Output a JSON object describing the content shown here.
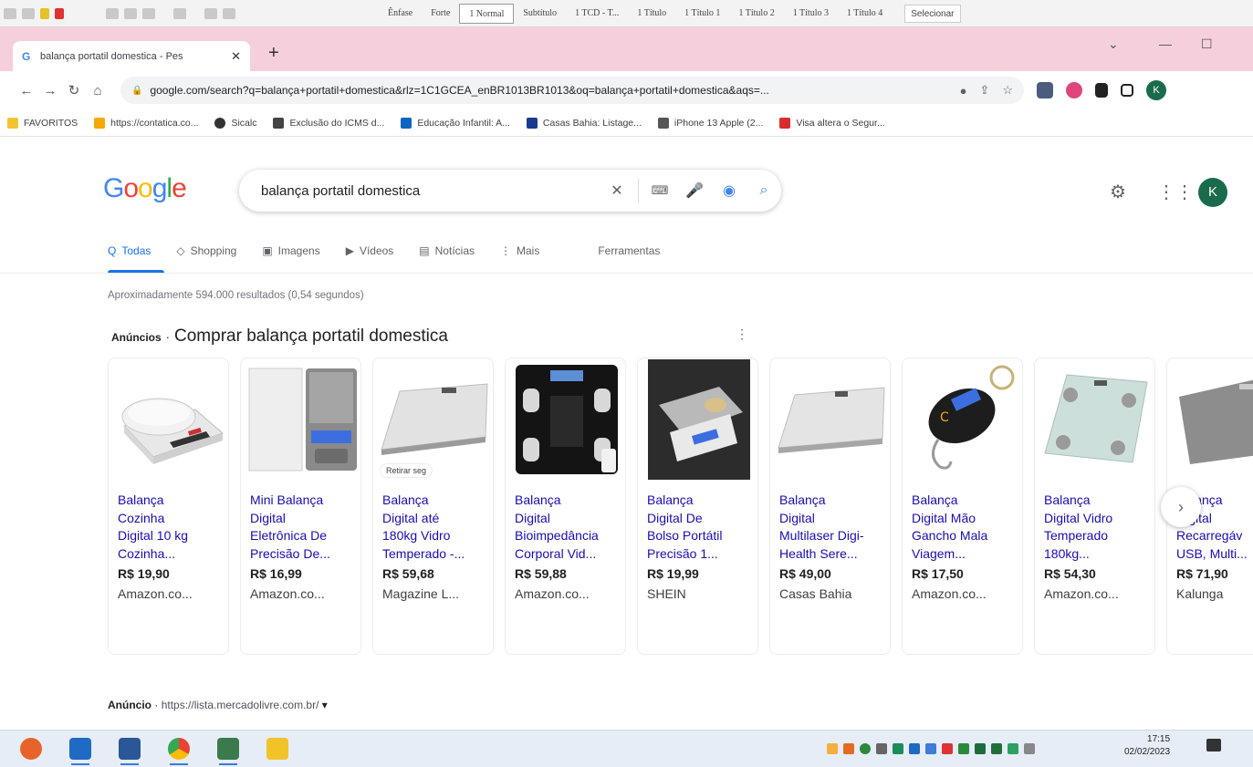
{
  "word_ribbon": {
    "styles": [
      "Ênfase",
      "Forte",
      "1 Normal",
      "Subtítulo",
      "1 TCD - T...",
      "1 Título",
      "1 Título 1",
      "1 Título 2",
      "1 Título 3",
      "1 Título 4"
    ],
    "active_style": "1 Normal",
    "select_label": "Selecionar"
  },
  "browser": {
    "tab_title": "balança portatil domestica - Pes",
    "tab_close": "✕",
    "new_tab": "+",
    "url": "google.com/search?q=balança+portatil+domestica&rlz=1C1GCEA_enBR1013BR1013&oq=balança+portatil+domestica&aqs=...",
    "bookmarks": [
      {
        "label": "FAVORITOS",
        "color": "#f4c430"
      },
      {
        "label": "https://contatica.co...",
        "color": "#f2a900"
      },
      {
        "label": "Sicalc",
        "color": "#333333"
      },
      {
        "label": "Exclusão do ICMS d...",
        "color": "#444444"
      },
      {
        "label": "Educação Infantil: A...",
        "color": "#0a66c2"
      },
      {
        "label": "Casas Bahia: Listage...",
        "color": "#1b3a8f"
      },
      {
        "label": "iPhone 13 Apple (2...",
        "color": "#555555"
      },
      {
        "label": "Visa altera o Segur...",
        "color": "#d92c2c"
      }
    ],
    "profile_initial": "K"
  },
  "google": {
    "logo_letters": [
      "G",
      "o",
      "o",
      "g",
      "l",
      "e"
    ],
    "query": "balança portatil domestica",
    "account_initial": "K",
    "search_tabs": [
      {
        "label": "Todas",
        "icon": "Q"
      },
      {
        "label": "Shopping",
        "icon": "◇"
      },
      {
        "label": "Imagens",
        "icon": "▣"
      },
      {
        "label": "Vídeos",
        "icon": "▶"
      },
      {
        "label": "Notícias",
        "icon": "▤"
      },
      {
        "label": "Mais",
        "icon": "⋮"
      }
    ],
    "tools_label": "Ferramentas",
    "result_stats": "Aproximadamente 594.000 resultados (0,54 segundos)",
    "ads_label": "Anúncios",
    "ads_title": "Comprar balança portatil domestica",
    "products": [
      {
        "title_lines": [
          "Balança",
          "Cozinha",
          "Digital 10 kg",
          "Cozinha..."
        ],
        "price": "R$ 19,90",
        "store": "Amazon.co...",
        "img": "kitchen-scale"
      },
      {
        "title_lines": [
          "Mini Balança",
          "Digital",
          "Eletrônica De",
          "Precisão De..."
        ],
        "price": "R$ 16,99",
        "store": "Amazon.co...",
        "img": "pocket-scale"
      },
      {
        "title_lines": [
          "Balança",
          "Digital até",
          "180kg Vidro",
          "Temperado -..."
        ],
        "price": "R$ 59,68",
        "store": "Magazine L...",
        "img": "glass-scale",
        "badge": "Retirar seg"
      },
      {
        "title_lines": [
          "Balança",
          "Digital",
          "Bioimpedância",
          "Corporal Vid..."
        ],
        "price": "R$ 59,88",
        "store": "Amazon.co...",
        "img": "bio-scale"
      },
      {
        "title_lines": [
          "Balança",
          "Digital De",
          "Bolso Portátil",
          "Precisão 1..."
        ],
        "price": "R$ 19,99",
        "store": "SHEIN",
        "img": "pocket-scale-dark"
      },
      {
        "title_lines": [
          "Balança",
          "Digital",
          "Multilaser Digi-",
          "Health Sere..."
        ],
        "price": "R$ 49,00",
        "store": "Casas Bahia",
        "img": "glass-scale"
      },
      {
        "title_lines": [
          "Balança",
          "Digital Mão",
          "Gancho Mala",
          "Viagem..."
        ],
        "price": "R$ 17,50",
        "store": "Amazon.co...",
        "img": "luggage-scale"
      },
      {
        "title_lines": [
          "Balança",
          "Digital Vidro",
          "Temperado",
          "180kg..."
        ],
        "price": "R$ 54,30",
        "store": "Amazon.co...",
        "img": "glass-clear-scale"
      },
      {
        "title_lines": [
          "Balança",
          "Digital",
          "Recarregáv",
          "USB, Multi..."
        ],
        "price": "R$ 71,90",
        "store": "Kalunga",
        "img": "gray-scale"
      }
    ],
    "next_arrow": "›",
    "ad2_label": "Anúncio",
    "ad2_url": "https://lista.mercadolivre.com.br/"
  },
  "taskbar": {
    "time": "17:15",
    "date": "02/02/2023"
  }
}
